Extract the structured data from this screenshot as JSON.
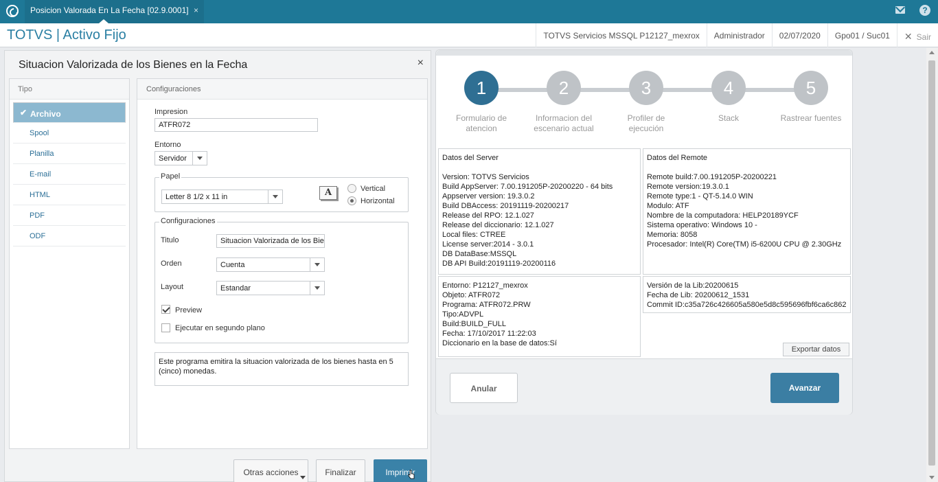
{
  "tab": {
    "title": "Posicion Valorada En La Fecha [02.9.0001]",
    "close": "×"
  },
  "header": {
    "app_title": "TOTVS | Activo Fijo",
    "server": "TOTVS Servicios MSSQL P12127_mexrox",
    "user": "Administrador",
    "date": "02/07/2020",
    "group": "Gpo01 / Suc01",
    "exit_label": "Sair",
    "exit_icon": "✕"
  },
  "dialog": {
    "title": "Situacion Valorizada de los Bienes en la Fecha",
    "close": "×",
    "tipo": {
      "header": "Tipo",
      "selected_check": "✔",
      "items": [
        "Archivo",
        "Spool",
        "Planilla",
        "E-mail",
        "HTML",
        "PDF",
        "ODF"
      ]
    },
    "config": {
      "header": "Configuraciones",
      "impresion_label": "Impresion",
      "impresion_value": "ATFR072",
      "entorno_label": "Entorno",
      "entorno_value": "Servidor",
      "papel_label": "Papel",
      "papel_value": "Letter 8 1/2 x 11 in",
      "orientation_icon_glyph": "A",
      "vertical_label": "Vertical",
      "horizontal_label": "Horizontal",
      "group_label": "Configuraciones",
      "titulo_label": "Titulo",
      "titulo_value": "Situacion Valorizada de los Bienes",
      "orden_label": "Orden",
      "orden_value": "Cuenta",
      "layout_label": "Layout",
      "layout_value": "Estandar",
      "preview_label": "Preview",
      "background_label": "Ejecutar en segundo plano",
      "description": "Este programa emitira la situacion valorizada de los bienes hasta en 5 (cinco) monedas."
    },
    "buttons": {
      "otras": "Otras acciones",
      "finalizar": "Finalizar",
      "imprimir": "Imprimir"
    }
  },
  "wizard": {
    "steps": [
      {
        "num": "1",
        "label": "Formulario de atencion"
      },
      {
        "num": "2",
        "label": "Informacion del escenario actual"
      },
      {
        "num": "3",
        "label": "Profiler de ejecución"
      },
      {
        "num": "4",
        "label": "Stack"
      },
      {
        "num": "5",
        "label": "Rastrear fuentes"
      }
    ],
    "server_box": {
      "title": "Datos del Server",
      "lines": [
        "Version: TOTVS Servicios",
        "Build AppServer: 7.00.191205P-20200220 - 64 bits",
        "Appserver version: 19.3.0.2",
        "Build DBAccess: 20191119-20200217",
        "Release del RPO:  12.1.027",
        "Release del diccionario: 12.1.027",
        "Local files: CTREE",
        "License server:2014 - 3.0.1",
        "DB DataBase:MSSQL",
        "DB API Build:20191119-20200116"
      ]
    },
    "remote_box": {
      "title": "Datos del Remote",
      "lines": [
        "Remote build:7.00.191205P-20200221",
        "Remote version:19.3.0.1",
        "Remote type:1 - QT-5.14.0 WIN",
        "Modulo: ATF",
        "Nombre de la computadora: HELP20189YCF",
        "Sistema operativo: Windows 10 -",
        "Memoria: 8058",
        "Procesador: Intel(R) Core(TM) i5-6200U CPU @ 2.30GHz"
      ]
    },
    "env_box": {
      "lines": [
        "Entorno: P12127_mexrox",
        "Objeto: ATFR072",
        "Programa: ATFR072.PRW",
        "Tipo:ADVPL",
        "Build:BUILD_FULL",
        "Fecha: 17/10/2017 11:22:03",
        "Diccionario en la base de datos:Sí"
      ]
    },
    "lib_box": {
      "lines": [
        "Versión de la Lib:20200615",
        "Fecha de Lib: 20200612_1531",
        "Commit ID:c35a726c426605a580e5d8c595696fbf6ca6c862"
      ]
    },
    "export_label": "Exportar datos",
    "anular_label": "Anular",
    "avanzar_label": "Avanzar"
  },
  "colors": {
    "topbar": "#1e7897",
    "accent": "#2f6f93",
    "selected_item": "#8cb8d0"
  }
}
